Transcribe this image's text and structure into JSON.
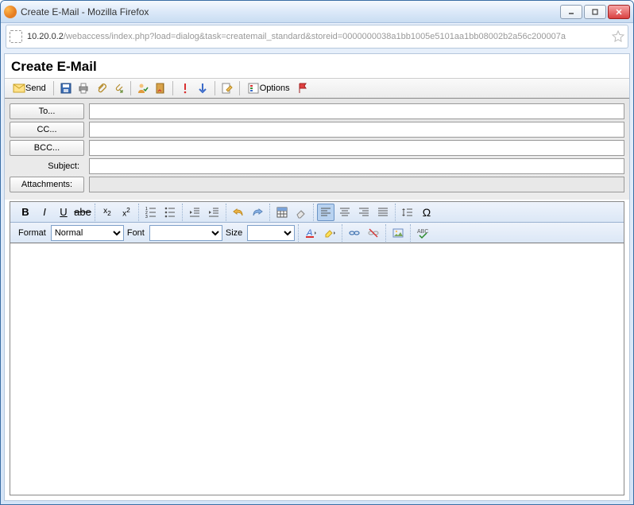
{
  "window": {
    "title": "Create E-Mail - Mozilla Firefox",
    "url_host": "10.20.0.2",
    "url_path": "/webaccess/index.php?load=dialog&task=createmail_standard&storeid=0000000038a1bb1005e5101aa1bb08002b2a56c200007a"
  },
  "page": {
    "title": "Create E-Mail"
  },
  "toolbar": {
    "send": "Send",
    "options": "Options"
  },
  "fields": {
    "to": "To...",
    "cc": "CC...",
    "bcc": "BCC...",
    "subject": "Subject:",
    "attachments": "Attachments:",
    "to_value": "",
    "cc_value": "",
    "bcc_value": "",
    "subject_value": ""
  },
  "editor": {
    "format_label": "Format",
    "format_value": "Normal",
    "font_label": "Font",
    "font_value": "",
    "size_label": "Size",
    "size_value": ""
  }
}
